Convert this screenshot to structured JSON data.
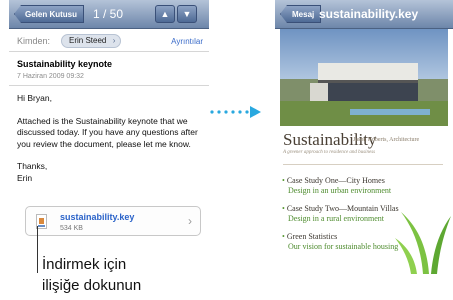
{
  "mail": {
    "back_label": "Gelen Kutusu",
    "counter": "1 / 50",
    "up_arrow": "▲",
    "down_arrow": "▼",
    "from_label": "Kimden:",
    "from_name": "Erin Steed",
    "details_label": "Ayrıntılar",
    "subject": "Sustainability keynote",
    "date": "7 Haziran 2009 09:32",
    "greeting": "Hi Bryan,",
    "body": "Attached is the Sustainability keynote that we discussed today. If you have any questions after you review the document, please let me know.",
    "signoff": "Thanks,",
    "signature": "Erin",
    "attachment": {
      "name": "sustainability.key",
      "size": "534 KB"
    }
  },
  "caption": {
    "line1": "İndirmek için",
    "line2": "ilişiğe dokunun"
  },
  "doc": {
    "back_label": "Mesaj",
    "title": "sustainability.key",
    "heading": "Sustainability",
    "byline": "Jason Roberts, Architecture",
    "tagline": "A greener approach to residence and business",
    "cases": [
      {
        "title": "Case Study One—City Homes",
        "desc": "Design in an urban environment"
      },
      {
        "title": "Case Study Two—Mountain Villas",
        "desc": "Design in a rural environment"
      },
      {
        "title": "Green Statistics",
        "desc": "Our vision for sustainable housing"
      }
    ]
  },
  "colors": {
    "nav_bar": "#6d86aa",
    "link_blue": "#2b63c9",
    "arrow_blue": "#29a8df",
    "doc_green": "#4d8b2d"
  },
  "icons": {
    "attachment": "keynote-file-icon",
    "arrow": "right-arrow-icon"
  }
}
